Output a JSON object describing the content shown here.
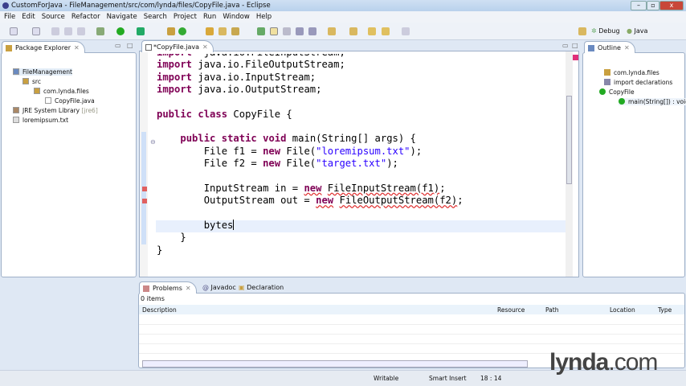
{
  "window": {
    "title": "CustomForJava - FileManagement/src/com/lynda/files/CopyFile.java - Eclipse"
  },
  "menu": [
    "File",
    "Edit",
    "Source",
    "Refactor",
    "Navigate",
    "Search",
    "Project",
    "Run",
    "Window",
    "Help"
  ],
  "perspectives": {
    "debug": "Debug",
    "java": "Java"
  },
  "package_explorer": {
    "title": "Package Explorer",
    "items": [
      {
        "label": "FileManagement",
        "icon": "project-icon"
      },
      {
        "label": "src",
        "icon": "source-folder-icon"
      },
      {
        "label": "com.lynda.files",
        "icon": "package-icon"
      },
      {
        "label": "CopyFile.java",
        "icon": "java-file-icon"
      },
      {
        "label": "JRE System Library",
        "suffix": "[jre6]",
        "icon": "library-icon"
      },
      {
        "label": "loremipsum.txt",
        "icon": "text-file-icon"
      }
    ]
  },
  "editor": {
    "tab": "*CopyFile.java",
    "code": [
      [
        [
          "kw",
          "import"
        ],
        [
          "",
          "  java.io.FileInputStream;"
        ]
      ],
      [
        [
          "kw",
          "import"
        ],
        [
          "",
          " java.io.FileOutputStream;"
        ]
      ],
      [
        [
          "kw",
          "import"
        ],
        [
          "",
          " java.io.InputStream;"
        ]
      ],
      [
        [
          "kw",
          "import"
        ],
        [
          "",
          " java.io.OutputStream;"
        ]
      ],
      [],
      [
        [
          "kw",
          "public"
        ],
        [
          "",
          " "
        ],
        [
          "kw",
          "class"
        ],
        [
          "",
          " CopyFile {"
        ]
      ],
      [],
      [
        [
          "",
          "    "
        ],
        [
          "kw",
          "public"
        ],
        [
          "",
          " "
        ],
        [
          "kw",
          "static"
        ],
        [
          "",
          " "
        ],
        [
          "kw",
          "void"
        ],
        [
          "",
          " main(String[] args) {"
        ]
      ],
      [
        [
          "",
          "        File f1 = "
        ],
        [
          "kw",
          "new"
        ],
        [
          "",
          " File("
        ],
        [
          "str",
          "\"loremipsum.txt\""
        ],
        [
          "",
          ");"
        ]
      ],
      [
        [
          "",
          "        File f2 = "
        ],
        [
          "kw",
          "new"
        ],
        [
          "",
          " File("
        ],
        [
          "str",
          "\"target.txt\""
        ],
        [
          "",
          ");"
        ]
      ],
      [],
      [
        [
          "",
          "        InputStream in = "
        ],
        [
          "kw err",
          "new"
        ],
        [
          "",
          " "
        ],
        [
          "err",
          "FileInputStream(f1)"
        ],
        [
          "",
          ";"
        ]
      ],
      [
        [
          "",
          "        OutputStream out = "
        ],
        [
          "kw err",
          "new"
        ],
        [
          "",
          " "
        ],
        [
          "err",
          "FileOutputStream(f2)"
        ],
        [
          "",
          ";"
        ]
      ],
      [],
      [
        [
          "",
          "        bytes"
        ],
        [
          "cursor",
          ""
        ]
      ],
      [
        [
          "",
          "    }"
        ]
      ],
      [
        [
          "",
          "}"
        ]
      ]
    ]
  },
  "outline": {
    "title": "Outline",
    "items": [
      "com.lynda.files",
      "import declarations",
      "CopyFile",
      "main(String[]) : void"
    ]
  },
  "bottom": {
    "tabs": [
      "Problems",
      "Javadoc",
      "Declaration"
    ],
    "count": "0 items",
    "columns": [
      "Description",
      "Resource",
      "Path",
      "Location",
      "Type"
    ]
  },
  "status": {
    "mode": "Writable",
    "insert": "Smart Insert",
    "position": "18 : 14"
  },
  "watermark": "lynda.com"
}
